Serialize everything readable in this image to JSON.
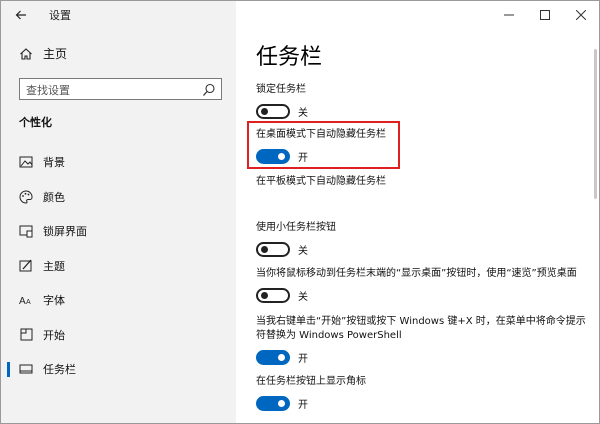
{
  "window": {
    "title": "设置",
    "controls": {
      "minimize": "—",
      "maximize": "☐",
      "close": "✕"
    }
  },
  "sidebar": {
    "home_label": "主页",
    "search": {
      "placeholder": "查找设置"
    },
    "section_title": "个性化",
    "items": [
      {
        "label": "背景",
        "icon": "image-icon"
      },
      {
        "label": "颜色",
        "icon": "palette-icon"
      },
      {
        "label": "锁屏界面",
        "icon": "lock-screen-icon"
      },
      {
        "label": "主题",
        "icon": "theme-icon"
      },
      {
        "label": "字体",
        "icon": "font-icon"
      },
      {
        "label": "开始",
        "icon": "start-icon"
      },
      {
        "label": "任务栏",
        "icon": "taskbar-icon",
        "selected": true
      }
    ]
  },
  "main": {
    "page_title": "任务栏",
    "settings": [
      {
        "label": "锁定任务栏",
        "state": "off",
        "state_label": "关"
      },
      {
        "label": "在桌面模式下自动隐藏任务栏",
        "state": "on",
        "state_label": "开"
      },
      {
        "label": "在平板模式下自动隐藏任务栏",
        "state": "off",
        "state_label": ""
      },
      {
        "label": "使用小任务栏按钮",
        "state": "off",
        "state_label": "关"
      },
      {
        "label": "当你将鼠标移动到任务栏末端的“显示桌面”按钮时，使用“速览”预览桌面",
        "state": "off",
        "state_label": "关"
      },
      {
        "label": "当我右键单击“开始”按钮或按下 Windows 键+X 时，在菜单中将命令提示符替换为 Windows PowerShell",
        "state": "on",
        "state_label": "开"
      },
      {
        "label": "在任务栏按钮上显示角标",
        "state": "on",
        "state_label": "开"
      }
    ]
  },
  "colors": {
    "accent": "#0067c0",
    "highlight_border": "#e02020",
    "sidebar_bg": "#f2f2f2"
  }
}
